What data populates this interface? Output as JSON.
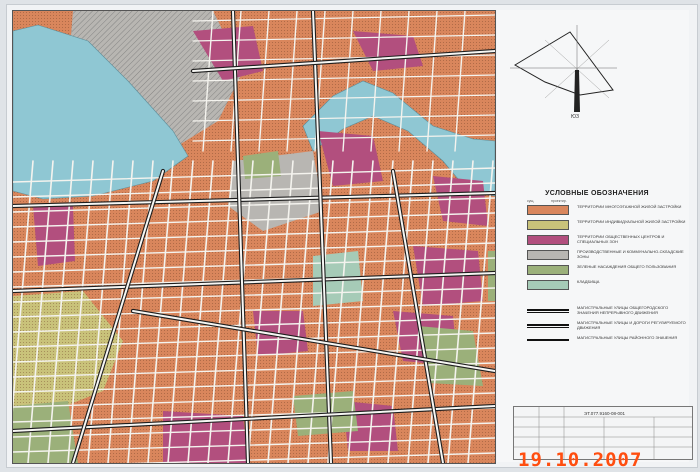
{
  "legend": {
    "title": "УСЛОВНЫЕ ОБОЗНАЧЕНИЯ",
    "col_left": "сущ.",
    "col_right": "проектир.",
    "items": [
      {
        "label": "ТЕРРИТОРИИ МНОГОЭТАЖНОЙ ЖИЛОЙ ЗАСТРОЙКИ",
        "color": "#d9865c"
      },
      {
        "label": "ТЕРРИТОРИИ ИНДИВИДУАЛЬНОЙ ЖИЛОЙ ЗАСТРОЙКИ",
        "color": "#c9c27a"
      },
      {
        "label": "ТЕРРИТОРИИ ОБЩЕСТВЕННЫХ ЦЕНТРОВ И СПЕЦИАЛЬНЫХ ЗОН",
        "color": "#b24f7e"
      },
      {
        "label": "ПРОИЗВОДСТВЕННЫЕ И КОММУНАЛЬНО-СКЛАДСКИЕ ЗОНЫ",
        "color": "#b8b6b2"
      },
      {
        "label": "ЗЕЛЕНЫЕ НАСАЖДЕНИЯ ОБЩЕГО ПОЛЬЗОВАНИЯ",
        "color": "#9bb07a"
      },
      {
        "label": "КЛАДБИЩА",
        "color": "#a6cbb7"
      }
    ],
    "road_items": [
      {
        "label": "МАГИСТРАЛЬНЫЕ УЛИЦЫ ОБЩЕГОРОДСКОГО ЗНАЧЕНИЯ НЕПРЕРЫВНОГО ДВИЖЕНИЯ"
      },
      {
        "label": "МАГИСТРАЛЬНЫЕ УЛИЦЫ И ДОРОГИ РЕГУЛИРУЕМОГО ДВИЖЕНИЯ"
      },
      {
        "label": "МАГИСТРАЛЬНЫЕ УЛИЦЫ РАЙОННОГО ЗНАЧЕНИЯ"
      }
    ]
  },
  "north_arrow": {
    "label": "ЮЗ"
  },
  "title_block": {
    "code": "ЭТ.077.9160-08-001"
  },
  "date_stamp": "19.10.2007",
  "colors": {
    "water": "#8fc7d3",
    "residential_multi": "#d9865c",
    "residential_individual": "#c9c27a",
    "public_centers": "#b24f7e",
    "industrial": "#b8b6b2",
    "green": "#9bb07a",
    "cemetery": "#a6cbb7",
    "road": "#f2f2f0"
  }
}
